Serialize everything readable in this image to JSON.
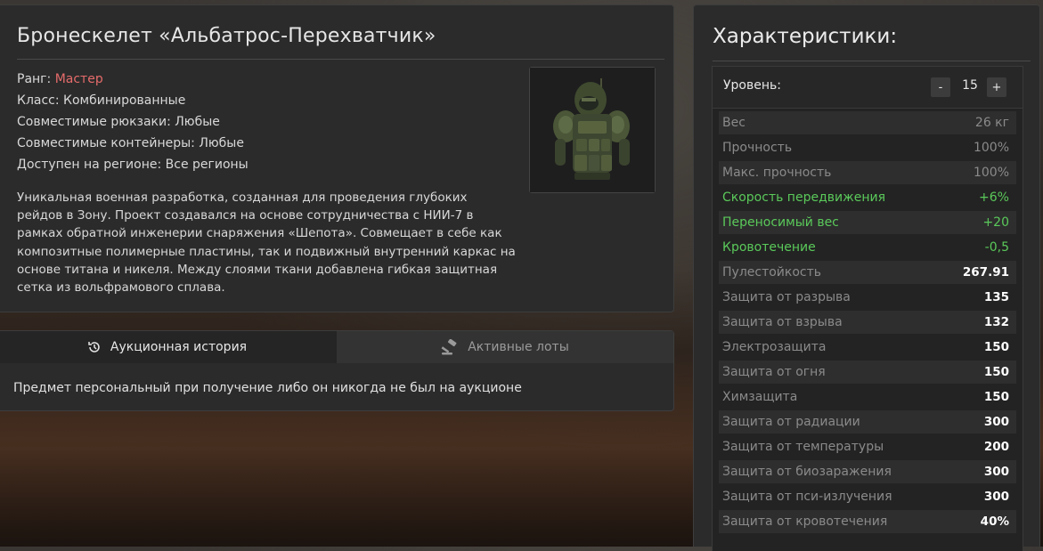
{
  "item": {
    "title": "Бронескелет «Альбатрос-Перехватчик»",
    "rank_label": "Ранг: ",
    "rank_value": "Мастер",
    "rank_color": "#e66b6b",
    "class": "Класс: Комбинированные",
    "backpacks": "Совместимые рюкзаки: Любые",
    "containers": "Совместимые контейнеры: Любые",
    "region": "Доступен на регионе: Все регионы",
    "image_icon": "armor-exoskeleton-image",
    "description": "Уникальная военная разработка, созданная для проведения глубоких рейдов в Зону. Проект создавался на основе сотрудничества с НИИ-7 в рамках обратной инженерии снаряжения «Шепота». Совмещает в себе как композитные полимерные пластины, так и подвижный внутренний каркас на основе титана и никеля. Между слоями ткани добавлена гибкая защитная сетка из вольфрамового сплава."
  },
  "tabs": [
    {
      "label": "Аукционная история",
      "icon": "history-icon",
      "active": true
    },
    {
      "label": "Активные лоты",
      "icon": "gavel-icon",
      "active": false
    }
  ],
  "tab_note": "Предмет персональный при получение либо он никогда не был на аукционе",
  "stats": {
    "title": "Характеристики:",
    "level_label": "Уровень:",
    "level_minus": "-",
    "level_value": "15",
    "level_plus": "+",
    "good_color": "#5ac95a",
    "rows": [
      {
        "name": "Вес",
        "value": "26 кг",
        "style": "dim"
      },
      {
        "name": "Прочность",
        "value": "100%",
        "style": "dim"
      },
      {
        "name": "Макс. прочность",
        "value": "100%",
        "style": "dim"
      },
      {
        "name": "Скорость передвижения",
        "value": "+6%",
        "style": "good"
      },
      {
        "name": "Переносимый вес",
        "value": "+20",
        "style": "good"
      },
      {
        "name": "Кровотечение",
        "value": "-0,5",
        "style": "good"
      },
      {
        "name": "Пулестойкость",
        "value": "267.91",
        "style": "bright"
      },
      {
        "name": "Защита от разрыва",
        "value": "135",
        "style": "bright"
      },
      {
        "name": "Защита от взрыва",
        "value": "132",
        "style": "bright"
      },
      {
        "name": "Электрозащита",
        "value": "150",
        "style": "bright"
      },
      {
        "name": "Защита от огня",
        "value": "150",
        "style": "bright"
      },
      {
        "name": "Химзащита",
        "value": "150",
        "style": "bright"
      },
      {
        "name": "Защита от радиации",
        "value": "300",
        "style": "bright"
      },
      {
        "name": "Защита от температуры",
        "value": "200",
        "style": "bright"
      },
      {
        "name": "Защита от биозаражения",
        "value": "300",
        "style": "bright"
      },
      {
        "name": "Защита от пси-излучения",
        "value": "300",
        "style": "bright"
      },
      {
        "name": "Защита от кровотечения",
        "value": "40%",
        "style": "bright"
      }
    ]
  }
}
